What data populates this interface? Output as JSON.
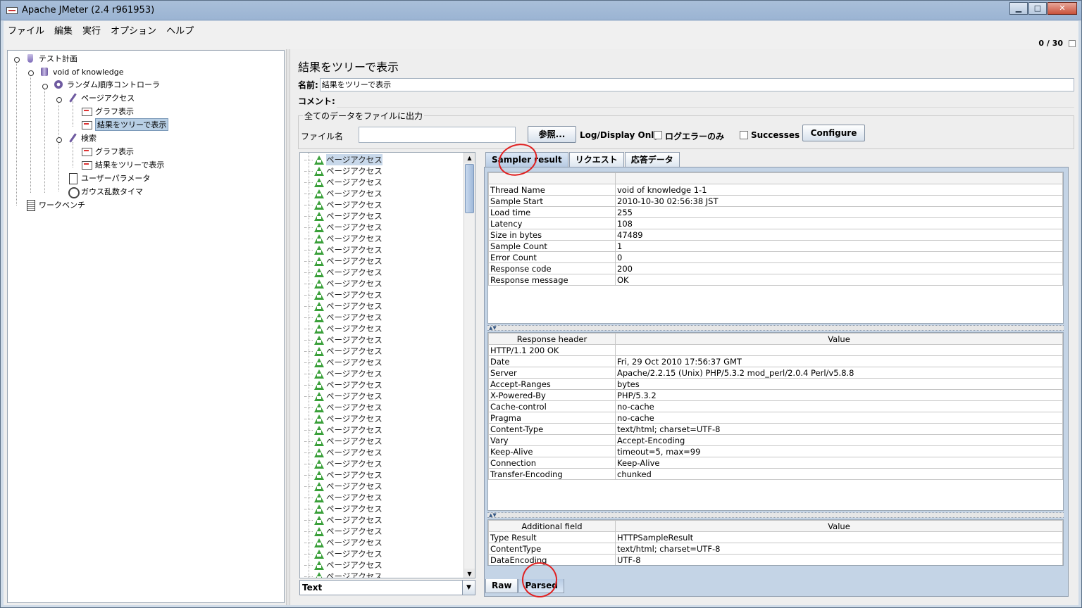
{
  "window": {
    "title": "Apache JMeter (2.4 r961953)",
    "buttons": [
      "▁",
      "□",
      "✕"
    ]
  },
  "menu": [
    "ファイル",
    "編集",
    "実行",
    "オプション",
    "ヘルプ"
  ],
  "status": {
    "counter": "0 / 30"
  },
  "tree": {
    "items": [
      {
        "label": "テスト計画",
        "icon": "flask-icon"
      },
      {
        "label": "void of knowledge",
        "icon": "thread-group-icon"
      },
      {
        "label": "ランダム順序コントローラ",
        "icon": "controller-icon"
      },
      {
        "label": "ページアクセス",
        "icon": "sampler-icon"
      },
      {
        "label": "グラフ表示",
        "icon": "graph-icon"
      },
      {
        "label": "結果をツリーで表示",
        "icon": "graph-icon"
      },
      {
        "label": "検索",
        "icon": "sampler-icon"
      },
      {
        "label": "グラフ表示",
        "icon": "graph-icon"
      },
      {
        "label": "結果をツリーで表示",
        "icon": "graph-icon"
      },
      {
        "label": "ユーザーパラメータ",
        "icon": "document-icon"
      },
      {
        "label": "ガウス乱数タイマ",
        "icon": "timer-icon"
      },
      {
        "label": "ワークベンチ",
        "icon": "clipboard-icon"
      }
    ]
  },
  "panel": {
    "title": "結果をツリーで表示",
    "name_label": "名前:",
    "name_value": "結果をツリーで表示",
    "comment_label": "コメント:",
    "comment_value": "",
    "file_group": {
      "legend": "全てのデータをファイルに出力",
      "file_label": "ファイル名",
      "file_value": "",
      "browse_label": "参照...",
      "log_only_label": "Log/Display Only:",
      "errors_label": "ログエラーのみ",
      "successes_label": "Successes",
      "configure_label": "Configure"
    }
  },
  "sample_list": {
    "item_label": "ページアクセス",
    "items": [
      "ページアクセス",
      "ページアクセス",
      "ページアクセス",
      "ページアクセス",
      "ページアクセス",
      "ページアクセス",
      "ページアクセス",
      "ページアクセス",
      "ページアクセス",
      "ページアクセス",
      "ページアクセス",
      "ページアクセス",
      "ページアクセス",
      "ページアクセス",
      "ページアクセス",
      "ページアクセス",
      "ページアクセス",
      "ページアクセス",
      "ページアクセス",
      "ページアクセス",
      "ページアクセス",
      "ページアクセス",
      "ページアクセス",
      "ページアクセス",
      "ページアクセス",
      "ページアクセス",
      "ページアクセス",
      "ページアクセス",
      "ページアクセス",
      "ページアクセス",
      "ページアクセス",
      "ページアクセス",
      "ページアクセス",
      "ページアクセス",
      "ページアクセス",
      "ページアクセス",
      "ページアクセス",
      "ページアクセス"
    ],
    "renderer": "Text"
  },
  "results": {
    "tabs": [
      "Sampler result",
      "リクエスト",
      "応答データ"
    ],
    "sampler_rows": [
      [
        "Thread Name",
        "void of knowledge 1-1"
      ],
      [
        "Sample Start",
        "2010-10-30 02:56:38 JST"
      ],
      [
        "Load time",
        "255"
      ],
      [
        "Latency",
        "108"
      ],
      [
        "Size in bytes",
        "47489"
      ],
      [
        "Sample Count",
        "1"
      ],
      [
        "Error Count",
        "0"
      ],
      [
        "Response code",
        "200"
      ],
      [
        "Response message",
        "OK"
      ]
    ],
    "header_columns": [
      "Response header",
      "Value"
    ],
    "header_rows": [
      [
        "HTTP/1.1 200 OK",
        ""
      ],
      [
        "Date",
        "Fri, 29 Oct 2010 17:56:37 GMT"
      ],
      [
        "Server",
        "Apache/2.2.15 (Unix) PHP/5.3.2 mod_perl/2.0.4 Perl/v5.8.8"
      ],
      [
        "Accept-Ranges",
        "bytes"
      ],
      [
        "X-Powered-By",
        "PHP/5.3.2"
      ],
      [
        "Cache-control",
        "no-cache"
      ],
      [
        "Pragma",
        "no-cache"
      ],
      [
        "Content-Type",
        "text/html; charset=UTF-8"
      ],
      [
        "Vary",
        "Accept-Encoding"
      ],
      [
        "Keep-Alive",
        "timeout=5, max=99"
      ],
      [
        "Connection",
        "Keep-Alive"
      ],
      [
        "Transfer-Encoding",
        "chunked"
      ]
    ],
    "additional_columns": [
      "Additional field",
      "Value"
    ],
    "additional_rows": [
      [
        "Type Result",
        "HTTPSampleResult"
      ],
      [
        "ContentType",
        "text/html; charset=UTF-8"
      ],
      [
        "DataEncoding",
        "UTF-8"
      ]
    ],
    "bottom_tabs": [
      "Raw",
      "Parsed"
    ]
  },
  "colors": {
    "annotation": "#e02020",
    "success": "#3aa03a",
    "selection": "#b8cfe5"
  }
}
